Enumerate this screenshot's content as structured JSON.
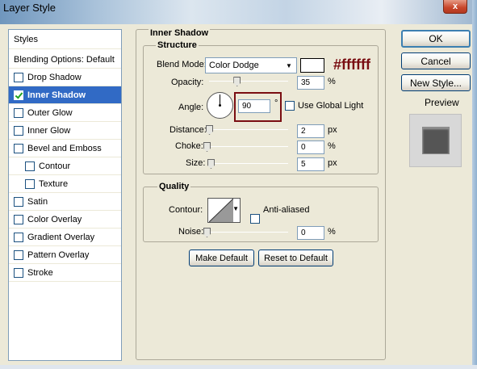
{
  "window": {
    "title": "Layer Style",
    "close_label": "x"
  },
  "styles_panel": {
    "header": "Styles",
    "items": [
      {
        "label": "Blending Options: Default",
        "checkbox": false,
        "checked": false,
        "selected": false,
        "indent": false
      },
      {
        "label": "Drop Shadow",
        "checkbox": true,
        "checked": false,
        "selected": false,
        "indent": false
      },
      {
        "label": "Inner Shadow",
        "checkbox": true,
        "checked": true,
        "selected": true,
        "indent": false
      },
      {
        "label": "Outer Glow",
        "checkbox": true,
        "checked": false,
        "selected": false,
        "indent": false
      },
      {
        "label": "Inner Glow",
        "checkbox": true,
        "checked": false,
        "selected": false,
        "indent": false
      },
      {
        "label": "Bevel and Emboss",
        "checkbox": true,
        "checked": false,
        "selected": false,
        "indent": false
      },
      {
        "label": "Contour",
        "checkbox": true,
        "checked": false,
        "selected": false,
        "indent": true
      },
      {
        "label": "Texture",
        "checkbox": true,
        "checked": false,
        "selected": false,
        "indent": true
      },
      {
        "label": "Satin",
        "checkbox": true,
        "checked": false,
        "selected": false,
        "indent": false
      },
      {
        "label": "Color Overlay",
        "checkbox": true,
        "checked": false,
        "selected": false,
        "indent": false
      },
      {
        "label": "Gradient Overlay",
        "checkbox": true,
        "checked": false,
        "selected": false,
        "indent": false
      },
      {
        "label": "Pattern Overlay",
        "checkbox": true,
        "checked": false,
        "selected": false,
        "indent": false
      },
      {
        "label": "Stroke",
        "checkbox": true,
        "checked": false,
        "selected": false,
        "indent": false
      }
    ]
  },
  "inner_shadow": {
    "section_title": "Inner Shadow",
    "structure": {
      "title": "Structure",
      "blend_mode_label": "Blend Mode:",
      "blend_mode_value": "Color Dodge",
      "color_value": "#ffffff",
      "color_annotation": "#ffffff",
      "opacity_label": "Opacity:",
      "opacity_value": "35",
      "opacity_unit": "%",
      "opacity_fraction": 0.35,
      "angle_label": "Angle:",
      "angle_value": "90",
      "angle_unit": "°",
      "angle_degrees": 90,
      "use_global_light_label": "Use Global Light",
      "use_global_light_checked": false,
      "distance_label": "Distance:",
      "distance_value": "2",
      "distance_unit": "px",
      "distance_fraction": 0.0,
      "choke_label": "Choke:",
      "choke_value": "0",
      "choke_unit": "%",
      "choke_fraction": 0.0,
      "size_label": "Size:",
      "size_value": "5",
      "size_unit": "px",
      "size_fraction": 0.02
    },
    "quality": {
      "title": "Quality",
      "contour_label": "Contour:",
      "anti_aliased_label": "Anti-aliased",
      "anti_aliased_checked": false,
      "noise_label": "Noise:",
      "noise_value": "0",
      "noise_unit": "%",
      "noise_fraction": 0.0
    },
    "make_default_label": "Make Default",
    "reset_to_default_label": "Reset to Default"
  },
  "buttons": {
    "ok": "OK",
    "cancel": "Cancel",
    "new_style": "New Style...",
    "preview_label": "Preview",
    "preview_checked": true
  },
  "colors": {
    "selection": "#316ac5",
    "annotation": "#7a0e12",
    "dialog_bg": "#ece9d8"
  }
}
